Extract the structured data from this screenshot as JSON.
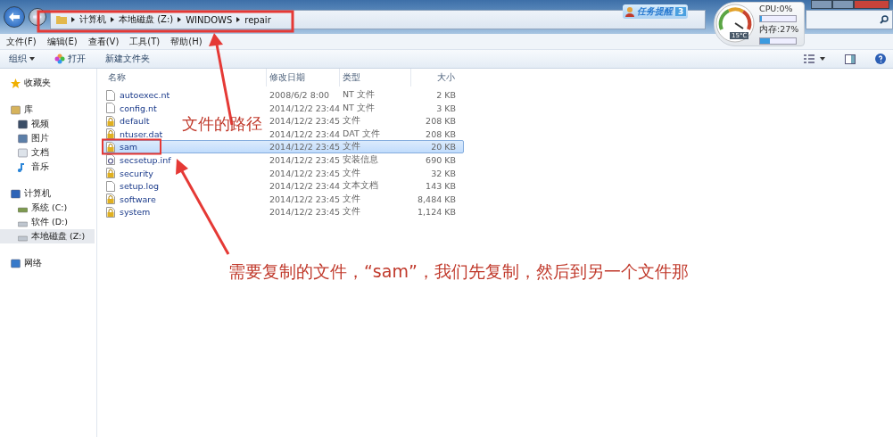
{
  "address_bar": {
    "segments": [
      "计算机",
      "本地磁盘 (Z:)",
      "WINDOWS",
      "repair"
    ]
  },
  "widget": {
    "task_reminder": {
      "label": "任务提醒",
      "count": "3"
    },
    "temperature": "15°C",
    "meters": [
      {
        "label": "CPU:0%",
        "level": 0.0
      },
      {
        "label": "内存:27%",
        "level": 0.27
      }
    ]
  },
  "menu_bar": [
    "文件(F)",
    "编辑(E)",
    "查看(V)",
    "工具(T)",
    "帮助(H)"
  ],
  "toolbar": {
    "organize": "组织",
    "open": "打开",
    "new_folder": "新建文件夹"
  },
  "sidebar": {
    "items": [
      {
        "label": "收藏夹",
        "kind": "favorites",
        "selected": false
      },
      {
        "label": "库",
        "kind": "library",
        "selected": false,
        "children": [
          {
            "label": "视频",
            "kind": "video",
            "selected": false
          },
          {
            "label": "图片",
            "kind": "pictures",
            "selected": false
          },
          {
            "label": "文档",
            "kind": "documents",
            "selected": false
          },
          {
            "label": "音乐",
            "kind": "music",
            "selected": false
          }
        ]
      },
      {
        "label": "计算机",
        "kind": "computer",
        "selected": false,
        "children": [
          {
            "label": "系统 (C:)",
            "kind": "system-drive",
            "selected": false
          },
          {
            "label": "软件 (D:)",
            "kind": "drive",
            "selected": false
          },
          {
            "label": "本地磁盘 (Z:)",
            "kind": "drive",
            "selected": true
          }
        ]
      },
      {
        "label": "网络",
        "kind": "network",
        "selected": false
      }
    ]
  },
  "table": {
    "columns": [
      "名称",
      "修改日期",
      "类型",
      "大小"
    ],
    "rows": [
      {
        "name": "autoexec.nt",
        "date": "2008/6/2 8:00",
        "type": "NT 文件",
        "size": "2 KB",
        "kind": "document",
        "selected": false
      },
      {
        "name": "config.nt",
        "date": "2014/12/2 23:44",
        "type": "NT 文件",
        "size": "3 KB",
        "kind": "document",
        "selected": false
      },
      {
        "name": "default",
        "date": "2014/12/2 23:45",
        "type": "文件",
        "size": "208 KB",
        "kind": "locked",
        "selected": false
      },
      {
        "name": "ntuser.dat",
        "date": "2014/12/2 23:44",
        "type": "DAT 文件",
        "size": "208 KB",
        "kind": "locked",
        "selected": false
      },
      {
        "name": "sam",
        "date": "2014/12/2 23:45",
        "type": "文件",
        "size": "20 KB",
        "kind": "locked",
        "selected": true
      },
      {
        "name": "secsetup.inf",
        "date": "2014/12/2 23:45",
        "type": "安装信息",
        "size": "690 KB",
        "kind": "setup",
        "selected": false
      },
      {
        "name": "security",
        "date": "2014/12/2 23:45",
        "type": "文件",
        "size": "32 KB",
        "kind": "locked",
        "selected": false
      },
      {
        "name": "setup.log",
        "date": "2014/12/2 23:44",
        "type": "文本文档",
        "size": "143 KB",
        "kind": "document",
        "selected": false
      },
      {
        "name": "software",
        "date": "2014/12/2 23:45",
        "type": "文件",
        "size": "8,484 KB",
        "kind": "locked",
        "selected": false
      },
      {
        "name": "system",
        "date": "2014/12/2 23:45",
        "type": "文件",
        "size": "1,124 KB",
        "kind": "locked",
        "selected": false
      }
    ]
  },
  "annotations": [
    {
      "text": "文件的路径",
      "kind": "path"
    },
    {
      "text": "需要复制的文件，“sam”，我们先复制，然后到另一个文件那",
      "kind": "file"
    }
  ]
}
